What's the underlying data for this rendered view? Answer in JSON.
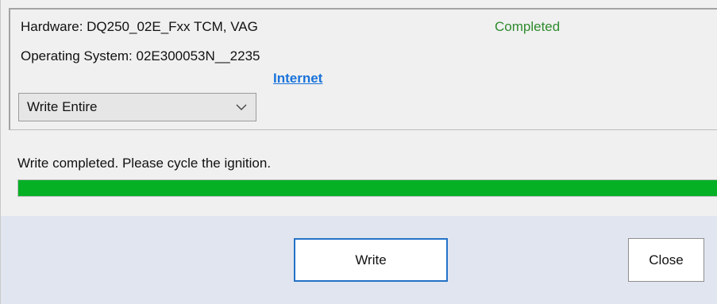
{
  "info": {
    "hardware": "Hardware: DQ250_02E_Fxx TCM, VAG",
    "status": "Completed",
    "operating_system": "Operating System: 02E300053N__2235",
    "internet_link": "Internet",
    "write_mode": {
      "selected": "Write Entire",
      "icon": "chevron-down-icon"
    }
  },
  "progress": {
    "message": "Write completed. Please cycle the ignition.",
    "percent": 100,
    "color": "#06b025"
  },
  "buttons": {
    "write_label": "Write",
    "close_label": "Close"
  },
  "colors": {
    "status_green": "#2e8b2e",
    "link_blue": "#1a73d9",
    "default_button_border": "#2472c8",
    "button_bar_bg": "#e1e5ef"
  }
}
